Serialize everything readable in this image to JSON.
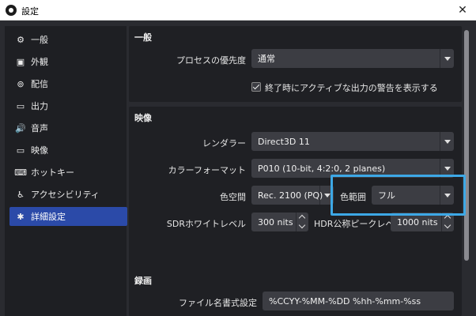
{
  "window": {
    "title": "設定",
    "close_glyph": "✕"
  },
  "sidebar": {
    "items": [
      {
        "label": "一般",
        "icon": "gear-icon",
        "glyph": "⚙"
      },
      {
        "label": "外観",
        "icon": "appearance-icon",
        "glyph": "▣"
      },
      {
        "label": "配信",
        "icon": "broadcast-icon",
        "glyph": "⊚"
      },
      {
        "label": "出力",
        "icon": "output-icon",
        "glyph": "▭"
      },
      {
        "label": "音声",
        "icon": "speaker-icon",
        "glyph": "🔊"
      },
      {
        "label": "映像",
        "icon": "monitor-icon",
        "glyph": "▭"
      },
      {
        "label": "ホットキー",
        "icon": "keyboard-icon",
        "glyph": "⌨"
      },
      {
        "label": "アクセシビリティ",
        "icon": "accessibility-icon",
        "glyph": "♿"
      },
      {
        "label": "詳細設定",
        "icon": "advanced-settings-icon",
        "glyph": "✱",
        "active": true
      }
    ]
  },
  "general": {
    "title": "一般",
    "process_priority_label": "プロセスの優先度",
    "process_priority_value": "通常",
    "warn_on_exit_label": "終了時にアクティブな出力の警告を表示する",
    "warn_on_exit_checked": true
  },
  "video": {
    "title": "映像",
    "renderer_label": "レンダラー",
    "renderer_value": "Direct3D 11",
    "color_format_label": "カラーフォーマット",
    "color_format_value": "P010 (10-bit, 4:2:0, 2 planes)",
    "color_space_label": "色空間",
    "color_space_value": "Rec. 2100 (PQ)",
    "color_range_label": "色範囲",
    "color_range_value": "フル",
    "sdr_white_label": "SDRホワイトレベル",
    "sdr_white_value": "300 nits",
    "hdr_peak_label": "HDR公称ピークレベル",
    "hdr_peak_value": "1000 nits"
  },
  "recording": {
    "title": "録画",
    "filename_format_label": "ファイル名書式設定",
    "filename_format_value": "%CCYY-%MM-%DD %hh-%mm-%ss"
  },
  "colors": {
    "accent_selection": "#2b4aa8",
    "highlight_box": "#3da8e6"
  }
}
